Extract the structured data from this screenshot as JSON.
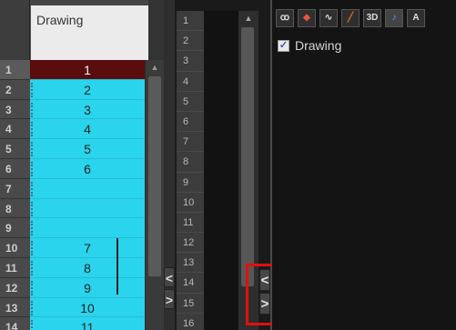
{
  "xsheet": {
    "column_header": "Drawing",
    "rows": [
      {
        "num": "1",
        "value": "1",
        "selected": true
      },
      {
        "num": "2",
        "value": "2"
      },
      {
        "num": "3",
        "value": "3"
      },
      {
        "num": "4",
        "value": "4"
      },
      {
        "num": "5",
        "value": "5"
      },
      {
        "num": "6",
        "value": "6"
      },
      {
        "num": "7",
        "value": ""
      },
      {
        "num": "8",
        "value": ""
      },
      {
        "num": "9",
        "value": ""
      },
      {
        "num": "10",
        "value": "7"
      },
      {
        "num": "11",
        "value": "8"
      },
      {
        "num": "12",
        "value": "9"
      },
      {
        "num": "13",
        "value": "10"
      },
      {
        "num": "14",
        "value": "11"
      }
    ],
    "gutter_buttons": [
      "<",
      ">"
    ]
  },
  "timeline": {
    "frame_numbers": [
      "1",
      "2",
      "3",
      "4",
      "5",
      "6",
      "7",
      "8",
      "9",
      "10",
      "11",
      "12",
      "13",
      "14",
      "15",
      "16"
    ],
    "buttons": [
      "<",
      ">"
    ]
  },
  "layer_panel": {
    "tools": [
      {
        "name": "onion-skin-icon",
        "label": "ꝏ"
      },
      {
        "name": "colour-layers-icon",
        "label": "◆"
      },
      {
        "name": "curve-icon",
        "label": "∿"
      },
      {
        "name": "pencil-icon",
        "label": "╱"
      },
      {
        "name": "3d-button",
        "label": "3D"
      },
      {
        "name": "sound-icon",
        "label": "♪"
      },
      {
        "name": "text-icon",
        "label": "A"
      }
    ],
    "layer": {
      "label": "Drawing",
      "checked": true
    }
  },
  "colors": {
    "cell_cyan": "#2ad4ec",
    "selected_cell": "#5a0d0d",
    "highlight": "#e10f0f"
  }
}
